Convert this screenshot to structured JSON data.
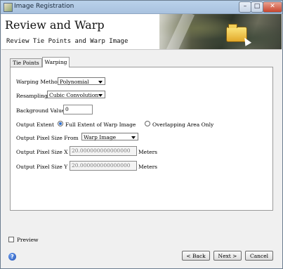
{
  "window": {
    "title": "Image Registration",
    "min_glyph": "–",
    "max_glyph": "□",
    "close_glyph": "✕"
  },
  "header": {
    "title": "Review and Warp",
    "subtitle": "Review Tie Points and Warp Image"
  },
  "tabs": [
    {
      "label": "Tie Points",
      "selected": false
    },
    {
      "label": "Warping",
      "selected": true
    }
  ],
  "form": {
    "warping_method": {
      "label": "Warping Method",
      "value": "Polynomial"
    },
    "resampling": {
      "label": "Resampling",
      "value": "Cubic Convolution"
    },
    "background_value": {
      "label": "Background Value",
      "value": "0"
    },
    "output_extent": {
      "label": "Output Extent",
      "options": [
        {
          "label": "Full Extent of Warp Image",
          "selected": true
        },
        {
          "label": "Overlapping Area Only",
          "selected": false
        }
      ]
    },
    "pixel_size_from": {
      "label": "Output Pixel Size From",
      "value": "Warp Image"
    },
    "pixel_size_x": {
      "label": "Output Pixel Size X",
      "value": "20.000000000000000",
      "unit": "Meters"
    },
    "pixel_size_y": {
      "label": "Output Pixel Size Y",
      "value": "20.000000000000000",
      "unit": "Meters"
    }
  },
  "footer": {
    "preview_label": "Preview",
    "help_glyph": "?",
    "back_label": "< Back",
    "next_label": "Next >",
    "cancel_label": "Cancel"
  },
  "colors": {
    "accent": "#2d6fcf",
    "titlebar": "#b9d1ea",
    "close": "#c7452d"
  }
}
